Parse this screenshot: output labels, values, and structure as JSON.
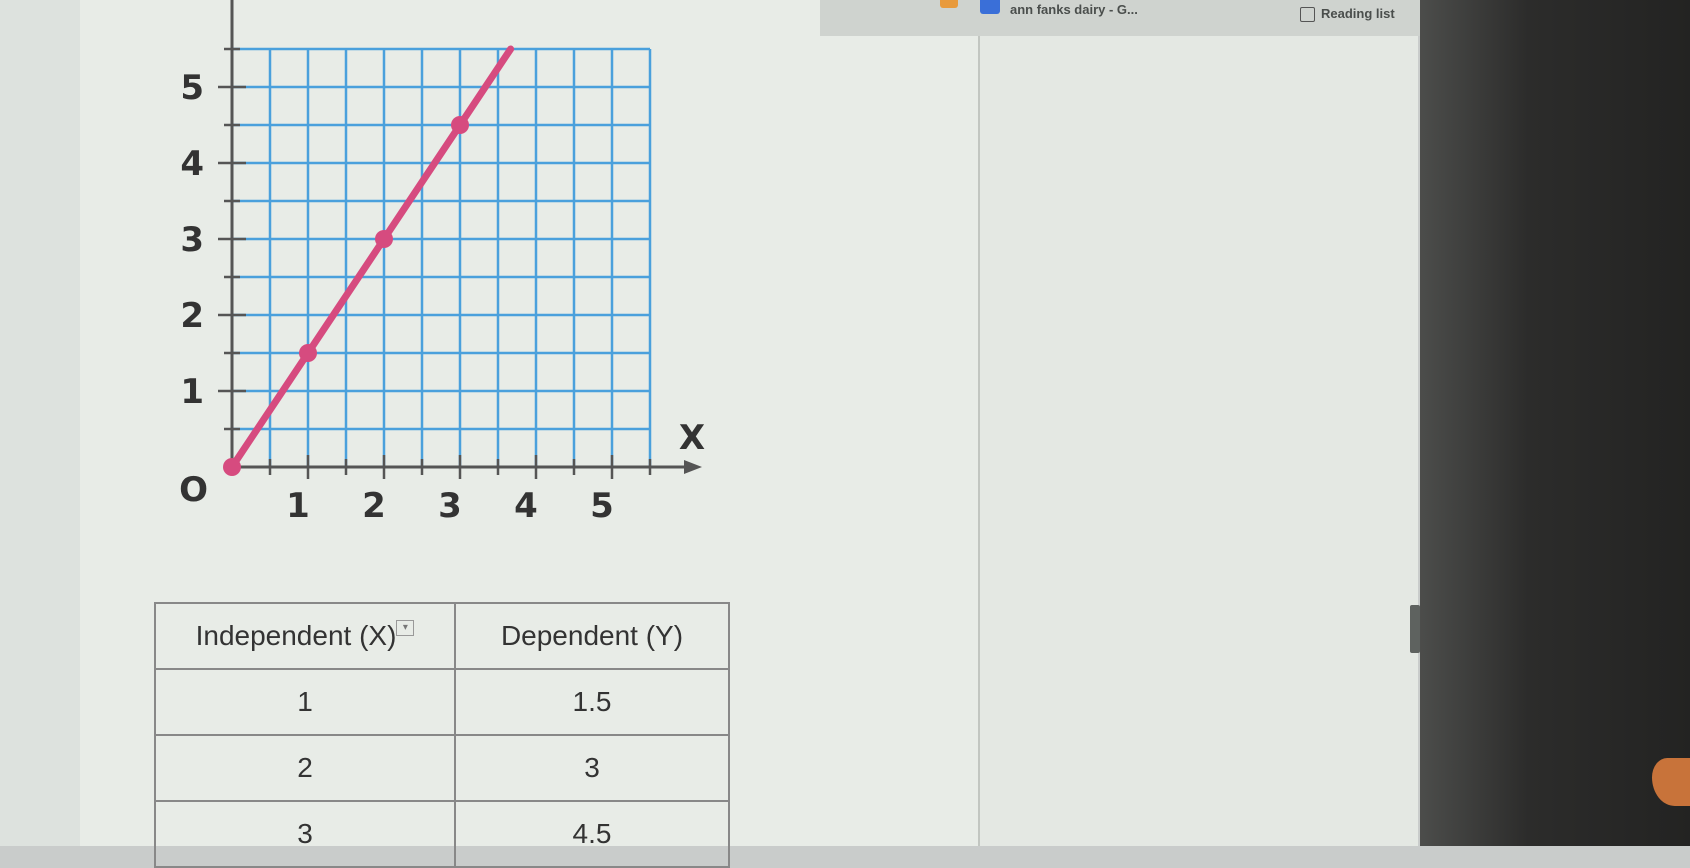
{
  "bookmarks": {
    "item1": "ann fanks dairy - G...",
    "reading_list": "Reading list"
  },
  "chart_data": {
    "type": "line",
    "x_axis_label": "X",
    "origin_label": "O",
    "x_ticks": [
      "1",
      "2",
      "3",
      "4",
      "5"
    ],
    "y_ticks": [
      "1",
      "2",
      "3",
      "4",
      "5"
    ],
    "xlim": [
      0,
      5.5
    ],
    "ylim": [
      0,
      5.5
    ],
    "grid": true,
    "series": [
      {
        "x": [
          0,
          1,
          2,
          3
        ],
        "y": [
          0,
          1.5,
          3,
          4.5
        ],
        "color": "#d64b7f"
      }
    ],
    "line_color": "#d64b7f",
    "grid_color": "#4aa0dc"
  },
  "table": {
    "headers": [
      "Independent (X)",
      "Dependent (Y)"
    ],
    "rows": [
      [
        "1",
        "1.5"
      ],
      [
        "2",
        "3"
      ],
      [
        "3",
        "4.5"
      ]
    ]
  }
}
